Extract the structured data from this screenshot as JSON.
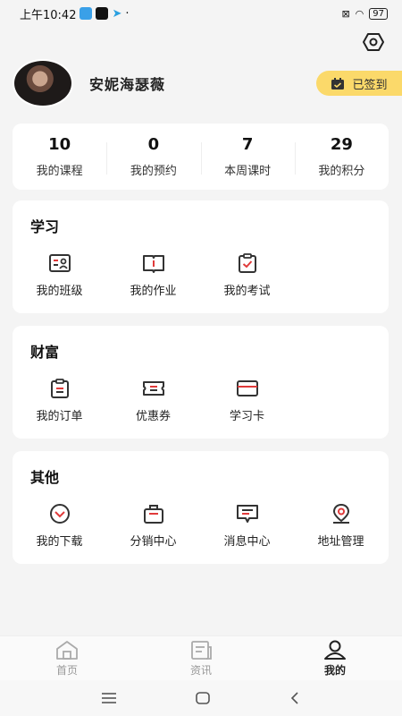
{
  "status_bar": {
    "time": "上午10:42",
    "battery": "97",
    "dot": "·"
  },
  "profile": {
    "username": "安妮海瑟薇"
  },
  "signin": {
    "label": "已签到"
  },
  "stats": [
    {
      "value": "10",
      "label": "我的课程"
    },
    {
      "value": "0",
      "label": "我的预约"
    },
    {
      "value": "7",
      "label": "本周课时"
    },
    {
      "value": "29",
      "label": "我的积分"
    }
  ],
  "sections": {
    "study": {
      "title": "学习",
      "items": [
        {
          "label": "我的班级",
          "icon": "class-icon"
        },
        {
          "label": "我的作业",
          "icon": "homework-icon"
        },
        {
          "label": "我的考试",
          "icon": "exam-icon"
        }
      ]
    },
    "wealth": {
      "title": "财富",
      "items": [
        {
          "label": "我的订单",
          "icon": "order-icon"
        },
        {
          "label": "优惠券",
          "icon": "coupon-icon"
        },
        {
          "label": "学习卡",
          "icon": "card-icon"
        }
      ]
    },
    "other": {
      "title": "其他",
      "items": [
        {
          "label": "我的下载",
          "icon": "download-icon"
        },
        {
          "label": "分销中心",
          "icon": "distribution-icon"
        },
        {
          "label": "消息中心",
          "icon": "message-icon"
        },
        {
          "label": "地址管理",
          "icon": "location-icon"
        }
      ]
    }
  },
  "tabbar": [
    {
      "label": "首页",
      "icon": "home-icon",
      "active": false
    },
    {
      "label": "资讯",
      "icon": "news-icon",
      "active": false
    },
    {
      "label": "我的",
      "icon": "profile-icon",
      "active": true
    }
  ],
  "colors": {
    "accent_red": "#e03a3a",
    "signin_bg": "#fbd96a",
    "icon_stroke": "#333333"
  }
}
